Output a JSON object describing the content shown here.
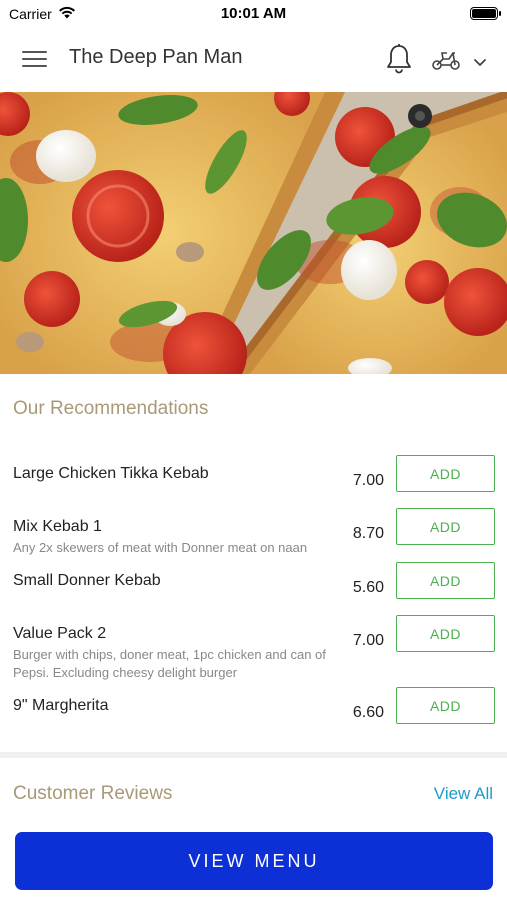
{
  "status_bar": {
    "carrier": "Carrier",
    "time": "10:01 AM"
  },
  "header": {
    "title": "The Deep Pan Man",
    "icons": [
      "menu-icon",
      "bell-icon",
      "scooter-icon",
      "chevron-down-icon"
    ]
  },
  "hero": {
    "image": "pizza-slices-photo"
  },
  "recommendations": {
    "title": "Our Recommendations",
    "add_label": "ADD",
    "items": [
      {
        "name": "Large Chicken Tikka Kebab",
        "description": "",
        "price": "7.00"
      },
      {
        "name": "Mix Kebab 1",
        "description": "Any 2x skewers of meat with Donner meat on naan",
        "price": "8.70"
      },
      {
        "name": "Small Donner Kebab",
        "description": "",
        "price": "5.60"
      },
      {
        "name": "Value Pack 2",
        "description": "Burger with chips, doner meat, 1pc chicken and can of Pepsi.  Excluding cheesy delight burger",
        "price": "7.00"
      },
      {
        "name": "9\" Margherita",
        "description": "",
        "price": "6.60"
      }
    ]
  },
  "reviews": {
    "title": "Customer Reviews",
    "view_all": "View All"
  },
  "footer": {
    "view_menu": "VIEW MENU"
  },
  "colors": {
    "accent_gold": "#a89a78",
    "add_green": "#4caf50",
    "link_blue": "#1e9bc9",
    "primary_button": "#0d2fd6"
  }
}
